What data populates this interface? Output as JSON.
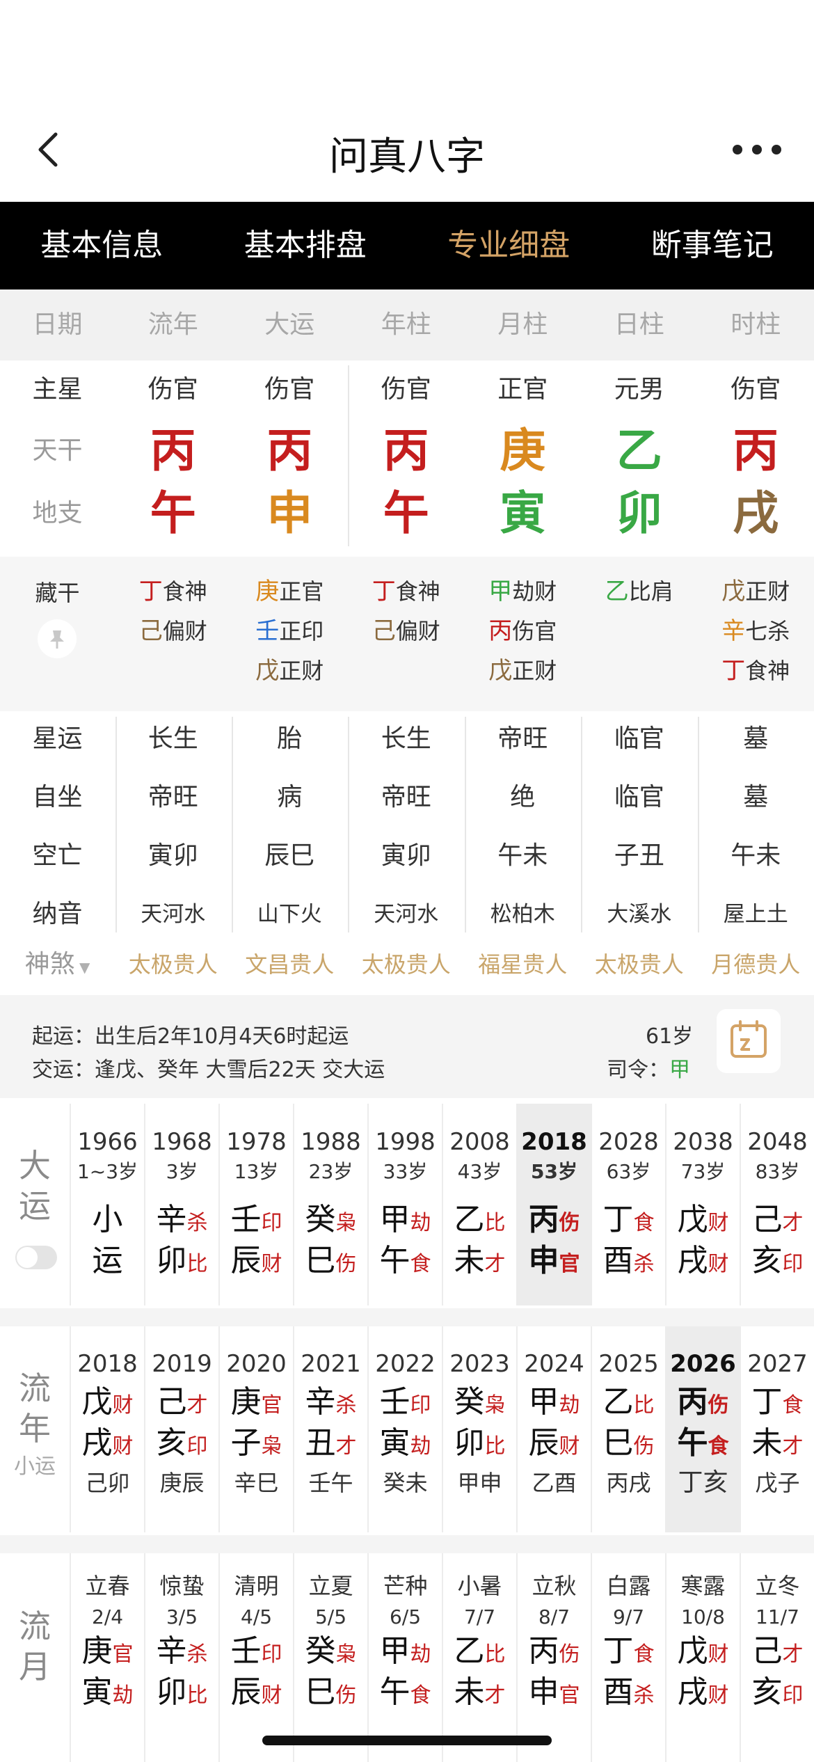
{
  "header": {
    "title": "问真八字"
  },
  "tabs": [
    {
      "label": "基本信息",
      "active": false
    },
    {
      "label": "基本排盘",
      "active": false
    },
    {
      "label": "专业细盘",
      "active": true
    },
    {
      "label": "断事笔记",
      "active": false
    }
  ],
  "columns": [
    "日期",
    "流年",
    "大运",
    "年柱",
    "月柱",
    "日柱",
    "时柱"
  ],
  "rows": {
    "star_label": "主星",
    "stars": [
      "伤官",
      "伤官",
      "伤官",
      "正官",
      "元男",
      "伤官"
    ],
    "stem_label": "天干",
    "stems": [
      {
        "char": "丙",
        "color": "#c41e1e"
      },
      {
        "char": "丙",
        "color": "#c41e1e"
      },
      {
        "char": "丙",
        "color": "#c41e1e"
      },
      {
        "char": "庚",
        "color": "#d9891f"
      },
      {
        "char": "乙",
        "color": "#39a845"
      },
      {
        "char": "丙",
        "color": "#c41e1e"
      }
    ],
    "branch_label": "地支",
    "branches": [
      {
        "char": "午",
        "color": "#c41e1e"
      },
      {
        "char": "申",
        "color": "#d9891f"
      },
      {
        "char": "午",
        "color": "#c41e1e"
      },
      {
        "char": "寅",
        "color": "#39a845"
      },
      {
        "char": "卯",
        "color": "#39a845"
      },
      {
        "char": "戌",
        "color": "#8b6a3e"
      }
    ]
  },
  "hidden_stems": {
    "label": "藏干",
    "cols": [
      [
        {
          "g": "丁",
          "gc": "#c41e1e",
          "t": "食神"
        },
        {
          "g": "己",
          "gc": "#8b6a3e",
          "t": "偏财"
        }
      ],
      [
        {
          "g": "庚",
          "gc": "#d9891f",
          "t": "正官"
        },
        {
          "g": "壬",
          "gc": "#2a6fd1",
          "t": "正印"
        },
        {
          "g": "戊",
          "gc": "#8b6a3e",
          "t": "正财"
        }
      ],
      [
        {
          "g": "丁",
          "gc": "#c41e1e",
          "t": "食神"
        },
        {
          "g": "己",
          "gc": "#8b6a3e",
          "t": "偏财"
        }
      ],
      [
        {
          "g": "甲",
          "gc": "#39a845",
          "t": "劫财"
        },
        {
          "g": "丙",
          "gc": "#c41e1e",
          "t": "伤官"
        },
        {
          "g": "戊",
          "gc": "#8b6a3e",
          "t": "正财"
        }
      ],
      [
        {
          "g": "乙",
          "gc": "#39a845",
          "t": "比肩"
        }
      ],
      [
        {
          "g": "戊",
          "gc": "#8b6a3e",
          "t": "正财"
        },
        {
          "g": "辛",
          "gc": "#d9891f",
          "t": "七杀"
        },
        {
          "g": "丁",
          "gc": "#c41e1e",
          "t": "食神"
        }
      ]
    ]
  },
  "details": {
    "xingyun": {
      "label": "星运",
      "values": [
        "长生",
        "胎",
        "长生",
        "帝旺",
        "临官",
        "墓"
      ]
    },
    "zizuo": {
      "label": "自坐",
      "values": [
        "帝旺",
        "病",
        "帝旺",
        "绝",
        "临官",
        "墓"
      ]
    },
    "kongwang": {
      "label": "空亡",
      "values": [
        "寅卯",
        "辰巳",
        "寅卯",
        "午未",
        "子丑",
        "午未"
      ]
    },
    "nayin": {
      "label": "纳音",
      "values": [
        "天河水",
        "山下火",
        "天河水",
        "松柏木",
        "大溪水",
        "屋上土"
      ]
    },
    "shensha": {
      "label": "神煞",
      "values": [
        "太极贵人",
        "文昌贵人",
        "太极贵人",
        "福星贵人",
        "太极贵人",
        "月德贵人"
      ]
    }
  },
  "info": {
    "qiyun": "起运：出生后2年10月4天6时起运",
    "jiaoyun": "交运：逢戊、癸年 大雪后22天 交大运",
    "age": "61岁",
    "siling_label": "司令：",
    "siling": "甲"
  },
  "dayun": {
    "label1": "大",
    "label2": "运",
    "cols": [
      {
        "year": "1966",
        "age": "1~3岁",
        "g": "小",
        "gt": "",
        "z": "运",
        "zt": "",
        "hl": false
      },
      {
        "year": "1968",
        "age": "3岁",
        "g": "辛",
        "gt": "杀",
        "z": "卯",
        "zt": "比",
        "hl": false
      },
      {
        "year": "1978",
        "age": "13岁",
        "g": "壬",
        "gt": "印",
        "z": "辰",
        "zt": "财",
        "hl": false
      },
      {
        "year": "1988",
        "age": "23岁",
        "g": "癸",
        "gt": "枭",
        "z": "巳",
        "zt": "伤",
        "hl": false
      },
      {
        "year": "1998",
        "age": "33岁",
        "g": "甲",
        "gt": "劫",
        "z": "午",
        "zt": "食",
        "hl": false
      },
      {
        "year": "2008",
        "age": "43岁",
        "g": "乙",
        "gt": "比",
        "z": "未",
        "zt": "才",
        "hl": false
      },
      {
        "year": "2018",
        "age": "53岁",
        "g": "丙",
        "gt": "伤",
        "z": "申",
        "zt": "官",
        "hl": true
      },
      {
        "year": "2028",
        "age": "63岁",
        "g": "丁",
        "gt": "食",
        "z": "酉",
        "zt": "杀",
        "hl": false
      },
      {
        "year": "2038",
        "age": "73岁",
        "g": "戊",
        "gt": "财",
        "z": "戌",
        "zt": "财",
        "hl": false
      },
      {
        "year": "2048",
        "age": "83岁",
        "g": "己",
        "gt": "才",
        "z": "亥",
        "zt": "印",
        "hl": false
      }
    ]
  },
  "liunian": {
    "label1": "流",
    "label2": "年",
    "label3": "小运",
    "cols": [
      {
        "year": "2018",
        "g": "戊",
        "gt": "财",
        "z": "戌",
        "zt": "财",
        "xy": "己卯",
        "hl": false
      },
      {
        "year": "2019",
        "g": "己",
        "gt": "才",
        "z": "亥",
        "zt": "印",
        "xy": "庚辰",
        "hl": false
      },
      {
        "year": "2020",
        "g": "庚",
        "gt": "官",
        "z": "子",
        "zt": "枭",
        "xy": "辛巳",
        "hl": false
      },
      {
        "year": "2021",
        "g": "辛",
        "gt": "杀",
        "z": "丑",
        "zt": "才",
        "xy": "壬午",
        "hl": false
      },
      {
        "year": "2022",
        "g": "壬",
        "gt": "印",
        "z": "寅",
        "zt": "劫",
        "xy": "癸未",
        "hl": false
      },
      {
        "year": "2023",
        "g": "癸",
        "gt": "枭",
        "z": "卯",
        "zt": "比",
        "xy": "甲申",
        "hl": false
      },
      {
        "year": "2024",
        "g": "甲",
        "gt": "劫",
        "z": "辰",
        "zt": "财",
        "xy": "乙酉",
        "hl": false
      },
      {
        "year": "2025",
        "g": "乙",
        "gt": "比",
        "z": "巳",
        "zt": "伤",
        "xy": "丙戌",
        "hl": false
      },
      {
        "year": "2026",
        "g": "丙",
        "gt": "伤",
        "z": "午",
        "zt": "食",
        "xy": "丁亥",
        "hl": true
      },
      {
        "year": "2027",
        "g": "丁",
        "gt": "食",
        "z": "未",
        "zt": "才",
        "xy": "戊子",
        "hl": false
      }
    ]
  },
  "liuyue": {
    "label1": "流",
    "label2": "月",
    "cols": [
      {
        "term": "立春",
        "date": "2/4",
        "g": "庚",
        "gt": "官",
        "z": "寅",
        "zt": "劫"
      },
      {
        "term": "惊蛰",
        "date": "3/5",
        "g": "辛",
        "gt": "杀",
        "z": "卯",
        "zt": "比"
      },
      {
        "term": "清明",
        "date": "4/5",
        "g": "壬",
        "gt": "印",
        "z": "辰",
        "zt": "财"
      },
      {
        "term": "立夏",
        "date": "5/5",
        "g": "癸",
        "gt": "枭",
        "z": "巳",
        "zt": "伤"
      },
      {
        "term": "芒种",
        "date": "6/5",
        "g": "甲",
        "gt": "劫",
        "z": "午",
        "zt": "食"
      },
      {
        "term": "小暑",
        "date": "7/7",
        "g": "乙",
        "gt": "比",
        "z": "未",
        "zt": "才"
      },
      {
        "term": "立秋",
        "date": "8/7",
        "g": "丙",
        "gt": "伤",
        "z": "申",
        "zt": "官"
      },
      {
        "term": "白露",
        "date": "9/7",
        "g": "丁",
        "gt": "食",
        "z": "酉",
        "zt": "杀"
      },
      {
        "term": "寒露",
        "date": "10/8",
        "g": "戊",
        "gt": "财",
        "z": "戌",
        "zt": "财"
      },
      {
        "term": "立冬",
        "date": "11/7",
        "g": "己",
        "gt": "才",
        "z": "亥",
        "zt": "印"
      }
    ]
  }
}
